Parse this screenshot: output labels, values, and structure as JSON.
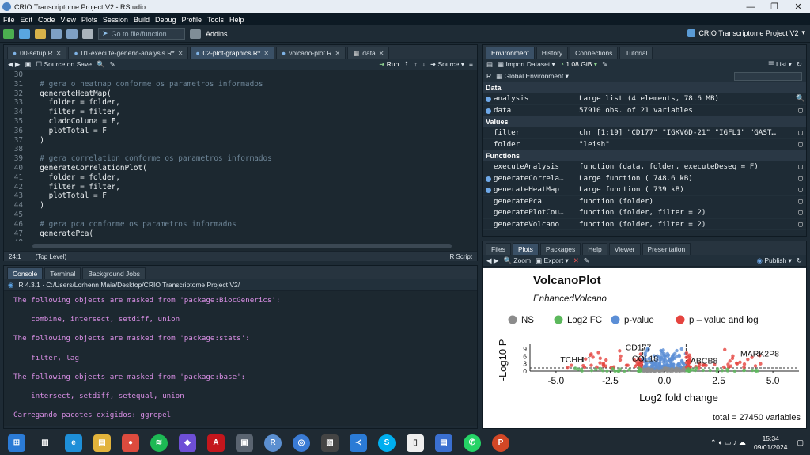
{
  "window": {
    "title": "CRIO Transcriptome Project V2 - RStudio",
    "min": "—",
    "max": "❐",
    "close": "✕"
  },
  "menu": [
    "File",
    "Edit",
    "Code",
    "View",
    "Plots",
    "Session",
    "Build",
    "Debug",
    "Profile",
    "Tools",
    "Help"
  ],
  "toolbar": {
    "goto": "Go to file/function",
    "addins": "Addins",
    "project": "CRIO Transcriptome Project V2"
  },
  "editor": {
    "tabs": [
      {
        "label": "00-setup.R",
        "active": false
      },
      {
        "label": "01-execute-generic-analysis.R*",
        "active": false
      },
      {
        "label": "02-plot-graphics.R*",
        "active": true
      },
      {
        "label": "volcano-plot.R",
        "active": false
      },
      {
        "label": "data",
        "active": false
      }
    ],
    "source_on_save": "Source on Save",
    "run": "Run",
    "source": "Source",
    "lines": [
      {
        "n": "30",
        "t": "",
        "c": false
      },
      {
        "n": "31",
        "t": "  # gera o heatmap conforme os parametros informados",
        "c": true
      },
      {
        "n": "32",
        "t": "  generateHeatMap(",
        "c": false
      },
      {
        "n": "33",
        "t": "    folder = folder,",
        "c": false
      },
      {
        "n": "34",
        "t": "    filter = filter,",
        "c": false
      },
      {
        "n": "35",
        "t": "    cladoColuna = F,",
        "c": false
      },
      {
        "n": "36",
        "t": "    plotTotal = F",
        "c": false
      },
      {
        "n": "37",
        "t": "  )",
        "c": false
      },
      {
        "n": "38",
        "t": "",
        "c": false
      },
      {
        "n": "39",
        "t": "  # gera correlation conforme os parametros informados",
        "c": true
      },
      {
        "n": "40",
        "t": "  generateCorrelationPlot(",
        "c": false
      },
      {
        "n": "41",
        "t": "    folder = folder,",
        "c": false
      },
      {
        "n": "42",
        "t": "    filter = filter,",
        "c": false
      },
      {
        "n": "43",
        "t": "    plotTotal = F",
        "c": false
      },
      {
        "n": "44",
        "t": "  )",
        "c": false
      },
      {
        "n": "45",
        "t": "",
        "c": false
      },
      {
        "n": "46",
        "t": "  # gera pca conforme os parametros informados",
        "c": true
      },
      {
        "n": "47",
        "t": "  generatePca(",
        "c": false
      },
      {
        "n": "48",
        "t": "",
        "c": false
      }
    ],
    "status_pos": "24:1",
    "status_scope": "(Top Level)",
    "status_type": "R Script"
  },
  "console": {
    "tabs": [
      "Console",
      "Terminal",
      "Background Jobs"
    ],
    "path": "R 4.3.1 · C:/Users/Lorhenn Maia/Desktop/CRIO Transcriptome Project V2/",
    "lines": [
      "The following objects are masked from 'package:BiocGenerics':",
      "    combine, intersect, setdiff, union",
      "The following objects are masked from 'package:stats':",
      "    filter, lag",
      "The following objects are masked from 'package:base':",
      "    intersect, setdiff, setequal, union",
      "Carregando pacotes exigidos: ggrepel",
      ">"
    ]
  },
  "env": {
    "tabs": [
      "Environment",
      "History",
      "Connections",
      "Tutorial"
    ],
    "import": "Import Dataset",
    "mem": "1.08 GiB",
    "list": "List",
    "lang": "R",
    "scope": "Global Environment",
    "sections": [
      {
        "title": "Data",
        "rows": [
          {
            "name": "analysis",
            "value": "Large list (4 elements,  78.6 MB)",
            "dot": true
          },
          {
            "name": "data",
            "value": "57910 obs. of 21 variables",
            "dot": true
          }
        ]
      },
      {
        "title": "Values",
        "rows": [
          {
            "name": "filter",
            "value": "chr [1:19] \"CD177\" \"IGKV6D-21\" \"IGFL1\" \"GAST…",
            "dot": false
          },
          {
            "name": "folder",
            "value": "\"leish\"",
            "dot": false
          }
        ]
      },
      {
        "title": "Functions",
        "rows": [
          {
            "name": "executeAnalysis",
            "value": "function (data, folder, executeDeseq = F)",
            "dot": false
          },
          {
            "name": "generateCorrela…",
            "value": "Large function ( 748.6 kB)",
            "dot": true
          },
          {
            "name": "generateHeatMap",
            "value": "Large function ( 739 kB)",
            "dot": true
          },
          {
            "name": "generatePca",
            "value": "function (folder)",
            "dot": false
          },
          {
            "name": "generatePlotCou…",
            "value": "function (folder, filter = 2)",
            "dot": false
          },
          {
            "name": "generateVolcano",
            "value": "function (folder, filter = 2)",
            "dot": false
          }
        ]
      }
    ]
  },
  "files": {
    "tabs": [
      "Files",
      "Plots",
      "Packages",
      "Help",
      "Viewer",
      "Presentation"
    ],
    "zoom": "Zoom",
    "export": "Export",
    "publish": "Publish"
  },
  "chart_data": {
    "type": "scatter",
    "title": "VolcanoPlot",
    "subtitle": "EnhancedVolcano",
    "xlabel": "Log2 fold change",
    "ylabel": "-Log10 P",
    "xticks": [
      "-5.0",
      "-2.5",
      "0.0",
      "2.5",
      "5.0"
    ],
    "yticks": [
      "0",
      "3",
      "6",
      "9"
    ],
    "xlim": [
      -6.2,
      6.2
    ],
    "ylim": [
      0,
      11
    ],
    "legend": [
      {
        "name": "NS",
        "color": "#8c8c8c"
      },
      {
        "name": "Log2 FC",
        "color": "#5cb85c"
      },
      {
        "name": "p-value",
        "color": "#5b8ed6"
      },
      {
        "name": "p – value and log",
        "color": "#e5443f"
      }
    ],
    "labels": [
      "CD177",
      "TCHH",
      "L1",
      "COL18",
      "ABCB8",
      "MARK2P8"
    ],
    "caption": "total = 27450 variables"
  },
  "taskbar": {
    "time": "15:34",
    "date": "09/01/2024"
  }
}
